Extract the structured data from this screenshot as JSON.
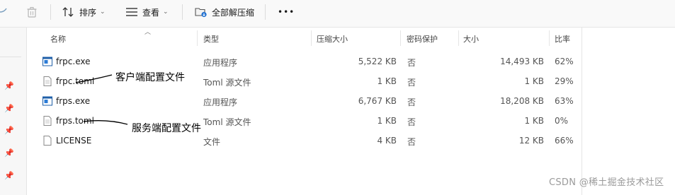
{
  "toolbar": {
    "sort_label": "排序",
    "view_label": "查看",
    "extract_label": "全部解压缩",
    "more_label": "•••"
  },
  "columns": {
    "name": "名称",
    "type": "类型",
    "compressed": "压缩大小",
    "password": "密码保护",
    "size": "大小",
    "ratio": "比率"
  },
  "files": [
    {
      "name": "frpc.exe",
      "type": "应用程序",
      "compressed": "5,522 KB",
      "password": "否",
      "size": "14,493 KB",
      "ratio": "62%",
      "icon": "exe-icon"
    },
    {
      "name": "frpc.toml",
      "type": "Toml 源文件",
      "compressed": "1 KB",
      "password": "否",
      "size": "1 KB",
      "ratio": "29%",
      "icon": "document-icon"
    },
    {
      "name": "frps.exe",
      "type": "应用程序",
      "compressed": "6,767 KB",
      "password": "否",
      "size": "18,208 KB",
      "ratio": "63%",
      "icon": "exe-icon"
    },
    {
      "name": "frps.toml",
      "type": "Toml 源文件",
      "compressed": "1 KB",
      "password": "否",
      "size": "1 KB",
      "ratio": "0%",
      "icon": "document-icon"
    },
    {
      "name": "LICENSE",
      "type": "文件",
      "compressed": "4 KB",
      "password": "否",
      "size": "12 KB",
      "ratio": "66%",
      "icon": "document-icon"
    }
  ],
  "annotations": {
    "client_config": "客户端配置文件",
    "server_config": "服务端配置文件"
  },
  "watermark": "CSDN @稀土掘金技术社区"
}
